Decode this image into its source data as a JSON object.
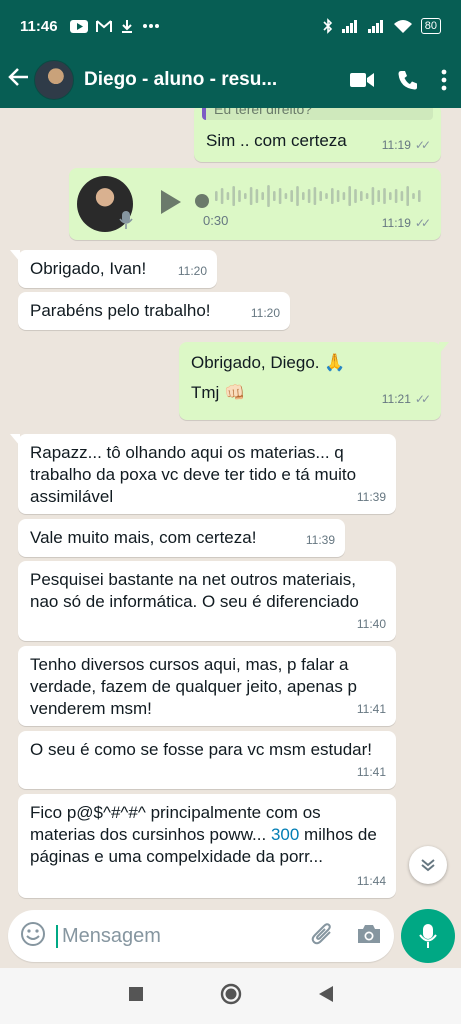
{
  "status_bar": {
    "time": "11:46",
    "left_icons": [
      "youtube-icon",
      "gmail-icon",
      "download-icon",
      "more-dots-icon"
    ],
    "right_icons": [
      "bluetooth-icon",
      "signal-icon",
      "signal-icon",
      "wifi-icon"
    ],
    "battery": "80"
  },
  "app_bar": {
    "contact_name": "Diego - aluno - resu...",
    "icons": [
      "back-arrow-icon",
      "video-call-icon",
      "phone-icon",
      "more-vert-icon"
    ]
  },
  "messages": [
    {
      "id": "m1",
      "dir": "out",
      "quote": "Eu terei direito?",
      "text": "Sim .. com certeza",
      "time": "11:19",
      "ticks": "✓✓"
    },
    {
      "id": "m2",
      "dir": "out",
      "type": "audio",
      "duration": "0:30",
      "time": "11:19",
      "ticks": "✓✓"
    },
    {
      "id": "m3",
      "dir": "in",
      "text": "Obrigado, Ivan!",
      "time": "11:20"
    },
    {
      "id": "m4",
      "dir": "in",
      "text": "Parabéns pelo trabalho!",
      "time": "11:20"
    },
    {
      "id": "m5",
      "dir": "out",
      "line1": "Obrigado, Diego. 🙏",
      "line2": "Tmj 👊🏻",
      "time": "11:21",
      "ticks": "✓✓"
    },
    {
      "id": "m6",
      "dir": "in",
      "text": "Rapazz... tô olhando aqui os materias... q trabalho da poxa vc deve ter tido e tá muito assimilável",
      "time": "11:39"
    },
    {
      "id": "m7",
      "dir": "in",
      "text": "Vale muito mais, com certeza!",
      "time": "11:39"
    },
    {
      "id": "m8",
      "dir": "in",
      "text": "Pesquisei bastante na net outros materiais, nao só de informática. O seu é diferenciado",
      "time": "11:40"
    },
    {
      "id": "m9",
      "dir": "in",
      "text": "Tenho diversos cursos aqui, mas, p falar a verdade, fazem de qualquer jeito, apenas p venderem msm!",
      "time": "11:41"
    },
    {
      "id": "m10",
      "dir": "in",
      "text": "O seu é como se fosse para vc msm estudar!",
      "time": "11:41"
    },
    {
      "id": "m11",
      "dir": "in",
      "text_before": "Fico p@$^#^#^ principalmente com os materias dos cursinhos poww... ",
      "link_number": "300",
      "text_after": " milhos de páginas e uma compelxidade da porr...",
      "time": "11:44"
    }
  ],
  "composer": {
    "placeholder": "Mensagem"
  },
  "colors": {
    "header": "#075e54",
    "outgoing_bubble": "#dcf8c6",
    "incoming_bubble": "#ffffff",
    "accent": "#00a884",
    "link": "#027eb5"
  }
}
